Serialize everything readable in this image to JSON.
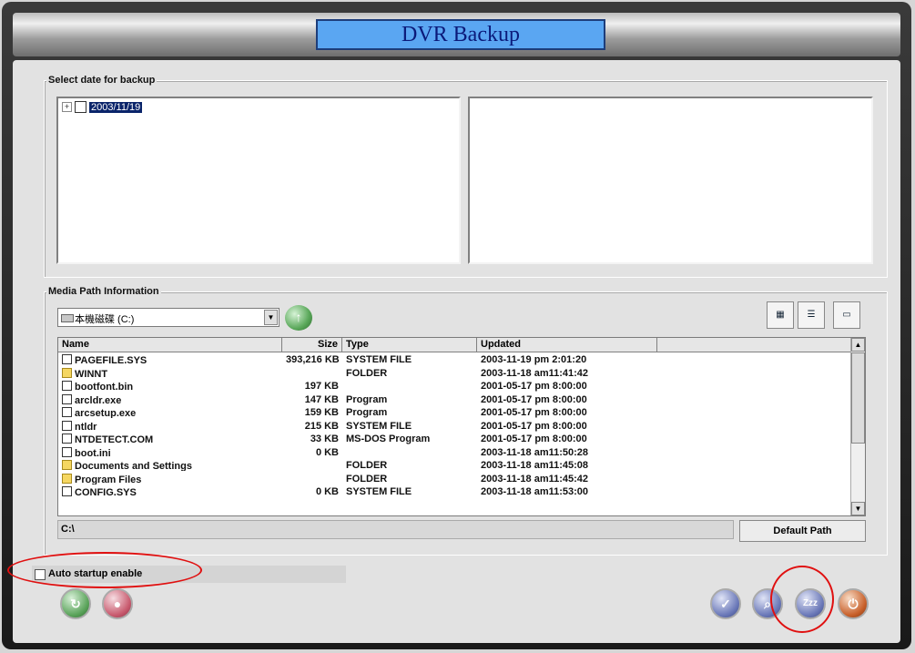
{
  "window": {
    "title": "DVR Backup"
  },
  "date_section": {
    "label": "Select date for backup",
    "tree_items": [
      {
        "expander": "+",
        "checked": false,
        "label": "2003/11/19"
      }
    ]
  },
  "media": {
    "label": "Media Path Information",
    "drive": "本機磁碟 (C:)",
    "columns": [
      "Name",
      "Size",
      "Type",
      "Updated"
    ],
    "rows": [
      {
        "name": "PAGEFILE.SYS",
        "size": "393,216 KB",
        "type": "SYSTEM FILE",
        "updated": "2003-11-19 pm 2:01:20",
        "icon": "file-icon"
      },
      {
        "name": "WINNT",
        "size": "",
        "type": "FOLDER",
        "updated": "2003-11-18 am11:41:42",
        "icon": "folder-icon"
      },
      {
        "name": "bootfont.bin",
        "size": "197 KB",
        "type": "",
        "updated": "2001-05-17 pm 8:00:00",
        "icon": "file-icon"
      },
      {
        "name": "arcldr.exe",
        "size": "147 KB",
        "type": "Program",
        "updated": "2001-05-17 pm 8:00:00",
        "icon": "program-icon"
      },
      {
        "name": "arcsetup.exe",
        "size": "159 KB",
        "type": "Program",
        "updated": "2001-05-17 pm 8:00:00",
        "icon": "program-icon"
      },
      {
        "name": "ntldr",
        "size": "215 KB",
        "type": "SYSTEM FILE",
        "updated": "2001-05-17 pm 8:00:00",
        "icon": "file-icon"
      },
      {
        "name": "NTDETECT.COM",
        "size": "33 KB",
        "type": "MS-DOS Program",
        "updated": "2001-05-17 pm 8:00:00",
        "icon": "program-icon"
      },
      {
        "name": "boot.ini",
        "size": "0 KB",
        "type": "",
        "updated": "2003-11-18 am11:50:28",
        "icon": "file-icon"
      },
      {
        "name": "Documents and Settings",
        "size": "",
        "type": "FOLDER",
        "updated": "2003-11-18 am11:45:08",
        "icon": "folder-icon"
      },
      {
        "name": "Program Files",
        "size": "",
        "type": "FOLDER",
        "updated": "2003-11-18 am11:45:42",
        "icon": "folder-icon"
      },
      {
        "name": "CONFIG.SYS",
        "size": "0 KB",
        "type": "SYSTEM FILE",
        "updated": "2003-11-18 am11:53:00",
        "icon": "file-icon"
      }
    ],
    "current_path": "C:\\",
    "default_path_label": "Default Path",
    "view_buttons": [
      "list-view-icon",
      "detail-view-icon",
      "thumbnail-view-icon"
    ]
  },
  "auto_startup": {
    "label": "Auto startup enable",
    "checked": false
  },
  "buttons": {
    "left": [
      {
        "name": "refresh-button",
        "icon": "refresh-icon",
        "color": "#5aa35a"
      },
      {
        "name": "record-button",
        "icon": "record-icon",
        "color": "#c85a6e"
      }
    ],
    "right": [
      {
        "name": "confirm-button",
        "icon": "check-icon",
        "color": "#6a78b8"
      },
      {
        "name": "search-button",
        "icon": "search-icon",
        "color": "#6a78b8"
      },
      {
        "name": "sleep-button",
        "icon": "sleep-icon",
        "glyph": "Zzz",
        "color": "#6a78b8"
      },
      {
        "name": "power-button",
        "icon": "power-icon",
        "color": "#c8602a"
      }
    ]
  },
  "annotation_color": "#e01010"
}
